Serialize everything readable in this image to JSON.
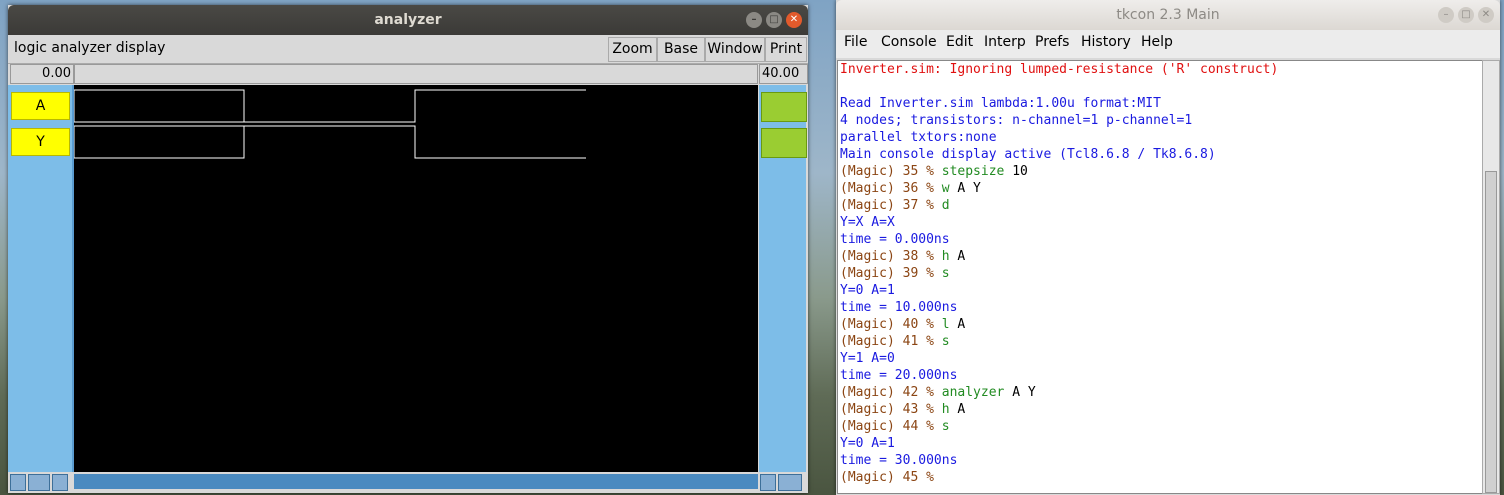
{
  "analyzer": {
    "title": "analyzer",
    "label": "logic analyzer display",
    "buttons": [
      "Zoom",
      "Base",
      "Window",
      "Print"
    ],
    "time_start": "0.00",
    "time_end": "40.00",
    "signals": [
      "A",
      "Y"
    ],
    "signal_color": "#ffff00",
    "value_color": "#9acd32"
  },
  "tkcon": {
    "title": "tkcon 2.3 Main",
    "menus": [
      "File",
      "Console",
      "Edit",
      "Interp",
      "Prefs",
      "History",
      "Help"
    ],
    "lines": [
      {
        "type": "err",
        "text": "Inverter.sim: Ignoring lumped-resistance ('R' construct)"
      },
      {
        "type": "blank",
        "text": ""
      },
      {
        "type": "out",
        "text": "Read Inverter.sim lambda:1.00u format:MIT"
      },
      {
        "type": "out",
        "text": "4 nodes; transistors: n-channel=1 p-channel=1"
      },
      {
        "type": "out",
        "text": "parallel txtors:none"
      },
      {
        "type": "out",
        "text": "Main console display active (Tcl8.6.8 / Tk8.6.8)"
      },
      {
        "type": "cmd",
        "prompt": "(Magic) 35 % ",
        "cmd": "stepsize",
        "arg": " 10"
      },
      {
        "type": "cmd",
        "prompt": "(Magic) 36 % ",
        "cmd": "w",
        "arg": " A Y"
      },
      {
        "type": "cmd",
        "prompt": "(Magic) 37 % ",
        "cmd": "d",
        "arg": ""
      },
      {
        "type": "out",
        "text": "Y=X A=X"
      },
      {
        "type": "out",
        "text": "time = 0.000ns"
      },
      {
        "type": "cmd",
        "prompt": "(Magic) 38 % ",
        "cmd": "h",
        "arg": " A"
      },
      {
        "type": "cmd",
        "prompt": "(Magic) 39 % ",
        "cmd": "s",
        "arg": ""
      },
      {
        "type": "out",
        "text": "Y=0 A=1"
      },
      {
        "type": "out",
        "text": "time = 10.000ns"
      },
      {
        "type": "cmd",
        "prompt": "(Magic) 40 % ",
        "cmd": "l",
        "arg": " A"
      },
      {
        "type": "cmd",
        "prompt": "(Magic) 41 % ",
        "cmd": "s",
        "arg": ""
      },
      {
        "type": "out",
        "text": "Y=1 A=0"
      },
      {
        "type": "out",
        "text": "time = 20.000ns"
      },
      {
        "type": "cmd",
        "prompt": "(Magic) 42 % ",
        "cmd": "analyzer",
        "arg": " A Y"
      },
      {
        "type": "cmd",
        "prompt": "(Magic) 43 % ",
        "cmd": "h",
        "arg": " A"
      },
      {
        "type": "cmd",
        "prompt": "(Magic) 44 % ",
        "cmd": "s",
        "arg": ""
      },
      {
        "type": "out",
        "text": "Y=0 A=1"
      },
      {
        "type": "out",
        "text": "time = 30.000ns"
      },
      {
        "type": "cmd",
        "prompt": "(Magic) 45 % ",
        "cmd": "",
        "arg": ""
      }
    ]
  }
}
